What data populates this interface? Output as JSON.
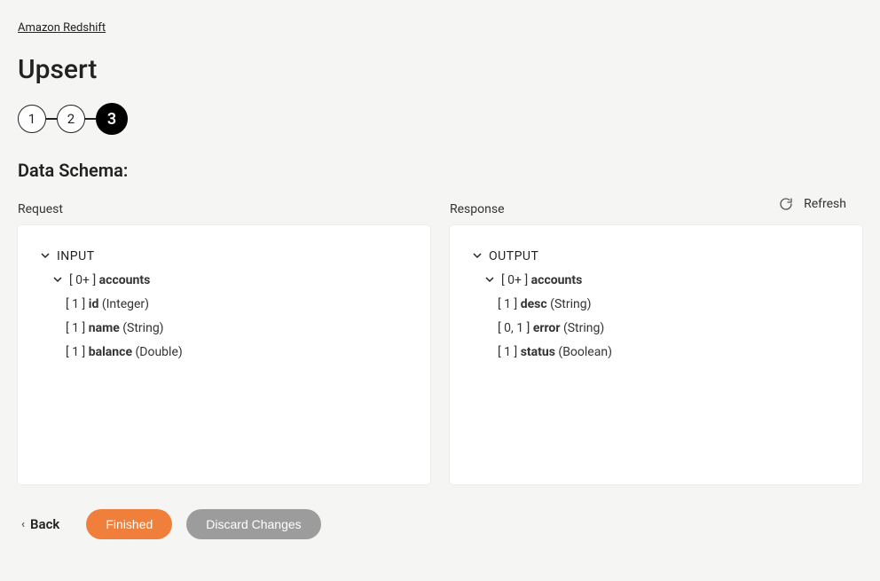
{
  "breadcrumb": {
    "parent": "Amazon Redshift"
  },
  "page": {
    "title": "Upsert",
    "section": "Data Schema:"
  },
  "stepper": {
    "steps": [
      "1",
      "2",
      "3"
    ],
    "active_index": 2
  },
  "actions": {
    "refresh": "Refresh"
  },
  "request": {
    "label": "Request",
    "root": "INPUT",
    "group_card": "[ 0+ ]",
    "group_name": "accounts",
    "fields": [
      {
        "card": "[ 1 ]",
        "name": "id",
        "type": "(Integer)"
      },
      {
        "card": "[ 1 ]",
        "name": "name",
        "type": "(String)"
      },
      {
        "card": "[ 1 ]",
        "name": "balance",
        "type": "(Double)"
      }
    ]
  },
  "response": {
    "label": "Response",
    "root": "OUTPUT",
    "group_card": "[ 0+ ]",
    "group_name": "accounts",
    "fields": [
      {
        "card": "[ 1 ]",
        "name": "desc",
        "type": "(String)"
      },
      {
        "card": "[ 0, 1 ]",
        "name": "error",
        "type": "(String)"
      },
      {
        "card": "[ 1 ]",
        "name": "status",
        "type": "(Boolean)"
      }
    ]
  },
  "footer": {
    "back": "Back",
    "finished": "Finished",
    "discard": "Discard Changes"
  }
}
